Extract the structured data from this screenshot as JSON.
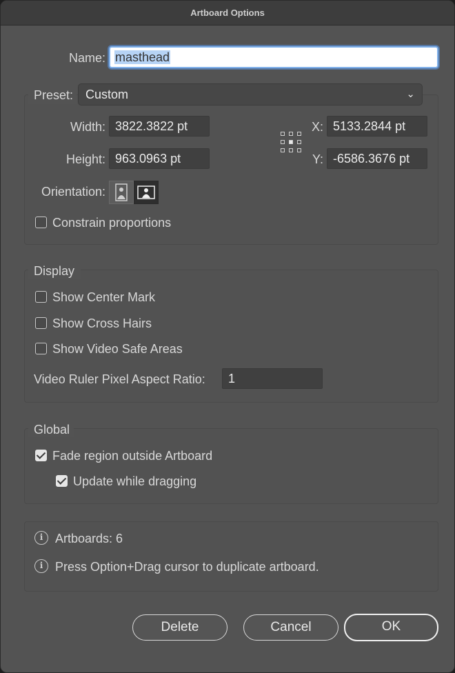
{
  "window": {
    "title": "Artboard Options"
  },
  "name": {
    "label": "Name:",
    "value": "masthead"
  },
  "preset": {
    "label": "Preset:",
    "value": "Custom",
    "width_label": "Width:",
    "width": "3822.3822 pt",
    "height_label": "Height:",
    "height": "963.0963 pt",
    "x_label": "X:",
    "x": "5133.2844 pt",
    "y_label": "Y:",
    "y": "-6586.3676 pt",
    "orientation_label": "Orientation:",
    "constrain_label": "Constrain proportions",
    "constrain_checked": false
  },
  "display": {
    "title": "Display",
    "center_mark": "Show Center Mark",
    "cross_hairs": "Show Cross Hairs",
    "video_safe": "Show Video Safe Areas",
    "aspect_label": "Video Ruler Pixel Aspect Ratio:",
    "aspect_value": "1"
  },
  "global": {
    "title": "Global",
    "fade_label": "Fade region outside Artboard",
    "fade_checked": true,
    "update_label": "Update while dragging",
    "update_checked": true
  },
  "info": {
    "artboards": "Artboards: 6",
    "hint": "Press Option+Drag cursor to duplicate artboard."
  },
  "buttons": {
    "delete": "Delete",
    "cancel": "Cancel",
    "ok": "OK"
  }
}
